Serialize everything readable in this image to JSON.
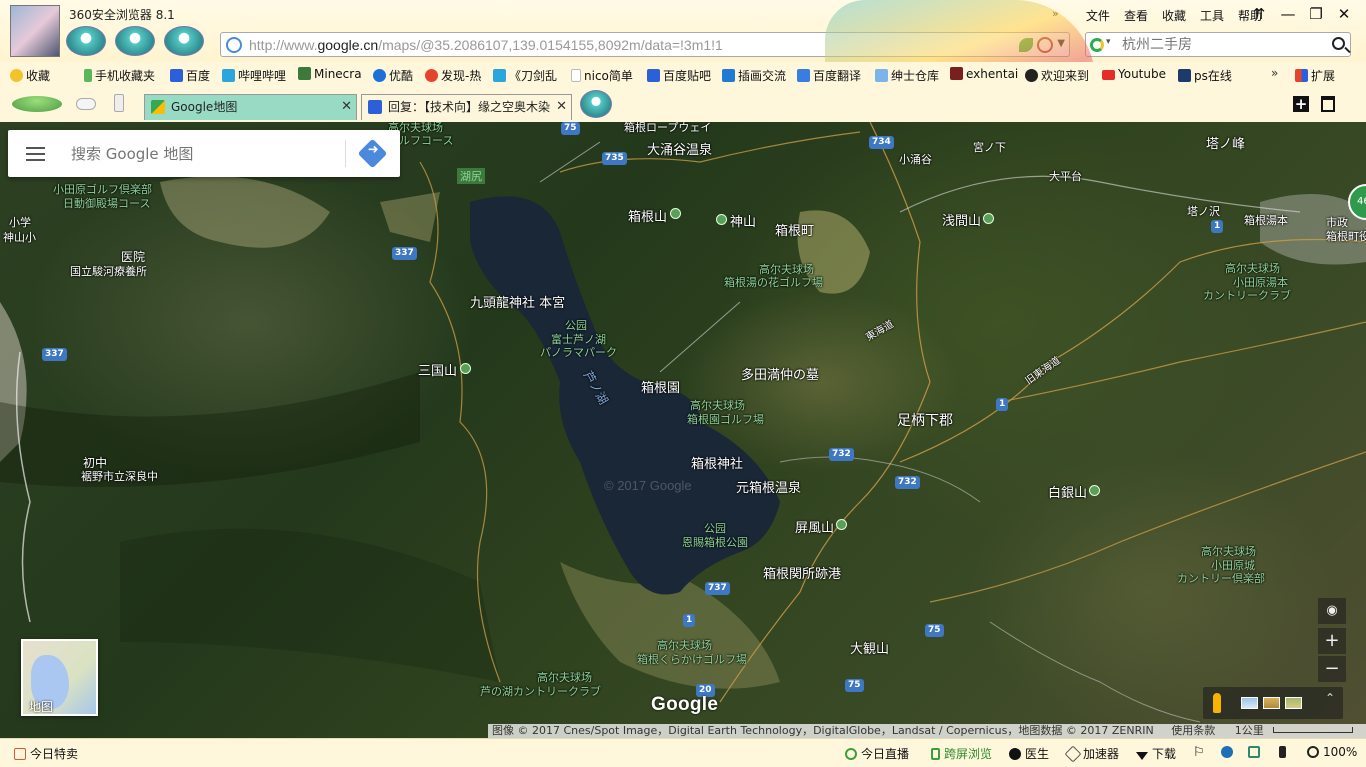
{
  "browser": {
    "title": "360安全浏览器 8.1",
    "menu": [
      "文件",
      "查看",
      "收藏",
      "工具",
      "帮助"
    ],
    "menu_arrow": "»",
    "window_controls": {
      "pin": "⇈",
      "minimize": "—",
      "restore": "❐",
      "close": "✕"
    },
    "address": {
      "prefix": "http://www.",
      "domain": "google.cn",
      "path": "/maps/@35.2086107,139.0154155,8092m/data=!3m1!1"
    },
    "search": {
      "placeholder": "杭州二手房"
    }
  },
  "bookmarks": {
    "items": [
      {
        "label": "收藏",
        "icon": "star-icon",
        "color": "#f3c32c"
      },
      {
        "label": "手机收藏夹",
        "icon": "phone-icon",
        "color": "#5bb55b"
      },
      {
        "label": "百度",
        "icon": "baidu-paw-icon",
        "color": "#2b60d8"
      },
      {
        "label": "哔哩哔哩",
        "icon": "bilibili-icon",
        "color": "#2aa6dc"
      },
      {
        "label": "Minecra",
        "icon": "minecraft-icon",
        "color": "#3c7a3c"
      },
      {
        "label": "优酷",
        "icon": "youku-icon",
        "color": "#1f6fd8"
      },
      {
        "label": "发现-热",
        "icon": "weibo-icon",
        "color": "#e6432b"
      },
      {
        "label": "《刀剑乱",
        "icon": "bilibili-icon",
        "color": "#2aa6dc"
      },
      {
        "label": "nico简单",
        "icon": "page-icon",
        "color": "#cccccc"
      },
      {
        "label": "百度贴吧",
        "icon": "baidu-paw-icon",
        "color": "#2b60d8"
      },
      {
        "label": "插画交流",
        "icon": "pixiv-icon",
        "color": "#1f7bd4"
      },
      {
        "label": "百度翻译",
        "icon": "translate-icon",
        "color": "#3a7de0"
      },
      {
        "label": "绅士仓库",
        "icon": "page-icon",
        "color": "#7ab4e8"
      },
      {
        "label": "exhentai",
        "icon": "eh-icon",
        "color": "#7a1f1f"
      },
      {
        "label": "欢迎来到",
        "icon": "steam-icon",
        "color": "#222222"
      },
      {
        "label": "Youtube",
        "icon": "youtube-icon",
        "color": "#e52d27"
      },
      {
        "label": "ps在线",
        "icon": "ps-icon",
        "color": "#1c3b6b"
      }
    ],
    "more": "»",
    "extend": "扩展"
  },
  "tabs": [
    {
      "label": "Google地图",
      "icon": "google-maps-icon",
      "active": true
    },
    {
      "label": "回复：【技术向】缘之空奥木染",
      "icon": "baidu-paw-icon",
      "active": false
    }
  ],
  "map": {
    "search_placeholder": "搜索 Google 地图",
    "layer_label": "地图",
    "google_logo": "Google",
    "watermark": "© 2017 Google",
    "attribution": "图像 © 2017 Cnes/Spot Image，Digital Earth Technology，DigitalGlobe，Landsat / Copernicus，地图数据 © 2017 ZENRIN",
    "terms": "使用条款",
    "scale": "1公里",
    "zoom_in": "+",
    "zoom_out": "−",
    "badge": "46",
    "labels": [
      {
        "text": "大涌谷温泉",
        "kind": "big"
      },
      {
        "text": "箱根山",
        "kind": "big"
      },
      {
        "text": "神山",
        "kind": "big"
      },
      {
        "text": "箱根町",
        "kind": "big"
      },
      {
        "text": "高尔夫球场",
        "kind": "green"
      },
      {
        "text": "箱根湯の花ゴルフ場",
        "kind": "green"
      },
      {
        "text": "九頭龍神社 本宮",
        "kind": "big"
      },
      {
        "text": "公园",
        "kind": "green"
      },
      {
        "text": "富士芦ノ湖",
        "kind": "green"
      },
      {
        "text": "パノラマパーク",
        "kind": "green"
      },
      {
        "text": "三国山",
        "kind": "big"
      },
      {
        "text": "箱根園",
        "kind": "big"
      },
      {
        "text": "高尔夫球场",
        "kind": "green"
      },
      {
        "text": "箱根園ゴルフ場",
        "kind": "green"
      },
      {
        "text": "芦ノ湖",
        "kind": "lake"
      },
      {
        "text": "多田満仲の墓",
        "kind": "big"
      },
      {
        "text": "足柄下郡",
        "kind": "big"
      },
      {
        "text": "箱根神社",
        "kind": "big"
      },
      {
        "text": "元箱根温泉",
        "kind": "big"
      },
      {
        "text": "屏風山",
        "kind": "big"
      },
      {
        "text": "公园",
        "kind": "green"
      },
      {
        "text": "恩賜箱根公園",
        "kind": "green"
      },
      {
        "text": "箱根関所跡港",
        "kind": "big"
      },
      {
        "text": "高尔夫球场",
        "kind": "green"
      },
      {
        "text": "箱根くらかけゴルフ場",
        "kind": "green"
      },
      {
        "text": "大観山",
        "kind": "big"
      },
      {
        "text": "高尔夫球场",
        "kind": "green"
      },
      {
        "text": "芦の湖カントリークラブ",
        "kind": "green"
      },
      {
        "text": "浅間山",
        "kind": "big"
      },
      {
        "text": "白銀山",
        "kind": "big"
      },
      {
        "text": "塔ノ峰",
        "kind": "big"
      },
      {
        "text": "小涌谷",
        "kind": "big"
      },
      {
        "text": "宮ノ下",
        "kind": "big"
      },
      {
        "text": "大平台",
        "kind": "big"
      },
      {
        "text": "塔ノ沢",
        "kind": "big"
      },
      {
        "text": "箱根湯本",
        "kind": "big"
      },
      {
        "text": "高尔夫球场",
        "kind": "green"
      },
      {
        "text": "小田原湯本",
        "kind": "green"
      },
      {
        "text": "カントリークラブ",
        "kind": "green"
      },
      {
        "text": "高尔夫球场",
        "kind": "green"
      },
      {
        "text": "小田原城",
        "kind": "green"
      },
      {
        "text": "カントリー倶楽部",
        "kind": "green"
      },
      {
        "text": "市政",
        "kind": "big"
      },
      {
        "text": "箱根町役",
        "kind": "big"
      },
      {
        "text": "東海道",
        "kind": "big"
      },
      {
        "text": "旧東海道",
        "kind": "big"
      },
      {
        "text": "医院",
        "kind": "big"
      },
      {
        "text": "国立駿河療養所",
        "kind": "big"
      },
      {
        "text": "初中",
        "kind": "big"
      },
      {
        "text": "裾野市立深良中",
        "kind": "big"
      },
      {
        "text": "小学",
        "kind": "big"
      },
      {
        "text": "神山小",
        "kind": "big"
      },
      {
        "text": "小田原ゴルフ倶楽部",
        "kind": "green"
      },
      {
        "text": "日動御殿場コース",
        "kind": "green"
      },
      {
        "text": "高尔夫球场",
        "kind": "green"
      },
      {
        "text": "ルフコース",
        "kind": "green"
      },
      {
        "text": "湖尻",
        "kind": "green"
      },
      {
        "text": "箱根ロープウェイ",
        "kind": "big"
      }
    ],
    "road_shields": [
      "75",
      "735",
      "734",
      "337",
      "337",
      "732",
      "732",
      "1",
      "1",
      "737",
      "1",
      "75",
      "75",
      "20"
    ]
  },
  "status": {
    "left": "今日特卖",
    "items": [
      "今日直播",
      "跨屏浏览",
      "医生",
      "加速器",
      "下载"
    ],
    "zoom": "100%"
  }
}
